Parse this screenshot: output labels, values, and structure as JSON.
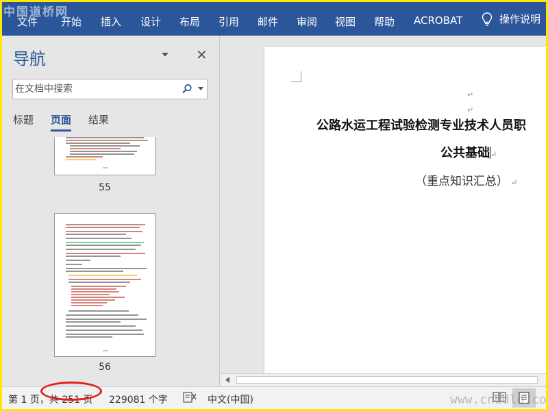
{
  "watermark_top": "中国道桥网",
  "watermark_bottom": "www.cnddlo.com",
  "ribbon": {
    "tabs": [
      "文件",
      "开始",
      "插入",
      "设计",
      "布局",
      "引用",
      "邮件",
      "审阅",
      "视图",
      "帮助",
      "ACROBAT"
    ],
    "tell_me": "操作说明",
    "tell_me_icon": "lightbulb-icon"
  },
  "nav": {
    "title": "导航",
    "search_placeholder": "在文档中搜索",
    "tabs": [
      "标题",
      "页面",
      "结果"
    ],
    "active_tab": "页面",
    "thumbnails": [
      {
        "label": "55"
      },
      {
        "label": "56"
      }
    ]
  },
  "document": {
    "title": "公路水运工程试验检测专业技术人员职",
    "subtitle": "公共基础",
    "note": "（重点知识汇总）",
    "para_mark": "↵"
  },
  "status": {
    "page": "第 1 页，共 251 页",
    "words": "229081 个字",
    "language": "中文(中国)",
    "accent_color": "#2b579a",
    "highlight_color": "#e02020"
  }
}
